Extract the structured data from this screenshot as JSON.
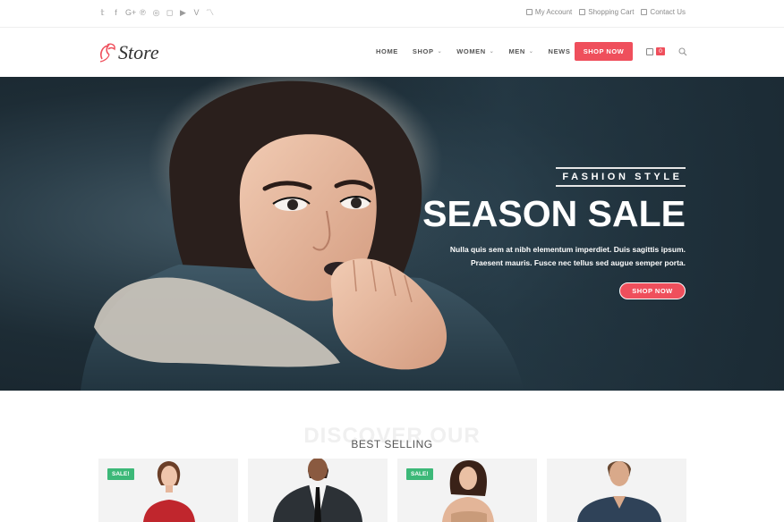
{
  "topbar": {
    "social_icons": [
      "twitter-icon",
      "facebook-icon",
      "google-plus-icon",
      "pinterest-icon",
      "dribbble-icon",
      "instagram-icon",
      "youtube-icon",
      "vimeo-icon",
      "rss-icon"
    ],
    "social_glyphs": [
      "𝕥",
      "f",
      "G+",
      "℗",
      "◎",
      "◻",
      "▶",
      "V",
      "〽"
    ],
    "links": [
      {
        "label": "My Account",
        "icon": "lock-icon"
      },
      {
        "label": "Shopping Cart",
        "icon": "bag-icon"
      },
      {
        "label": "Contact Us",
        "icon": "home-icon"
      }
    ]
  },
  "header": {
    "logo_text": "Store",
    "nav": [
      {
        "label": "HOME",
        "has_dropdown": false
      },
      {
        "label": "SHOP",
        "has_dropdown": true
      },
      {
        "label": "WOMEN",
        "has_dropdown": true
      },
      {
        "label": "MEN",
        "has_dropdown": true
      },
      {
        "label": "NEWS",
        "has_dropdown": false
      }
    ],
    "shop_now_label": "SHOP NOW",
    "cart_count": "0"
  },
  "hero": {
    "kicker": "FASHION STYLE",
    "headline": "SEASON SALE",
    "desc_line1": "Nulla quis sem at nibh elementum imperdiet. Duis sagittis ipsum.",
    "desc_line2": "Praesent mauris. Fusce nec tellus sed augue semper porta.",
    "button_label": "SHOP NOW"
  },
  "section": {
    "ghost_title": "DISCOVER OUR",
    "title": "BEST SELLING"
  },
  "products": [
    {
      "badge": "SALE!",
      "figure": "woman-red-top"
    },
    {
      "badge": "",
      "figure": "man-suit"
    },
    {
      "badge": "SALE!",
      "figure": "woman-tan-dress"
    },
    {
      "badge": "",
      "figure": "man-denim-shirt"
    }
  ],
  "colors": {
    "accent": "#ef4f5c",
    "sale_badge": "#3cb878"
  }
}
